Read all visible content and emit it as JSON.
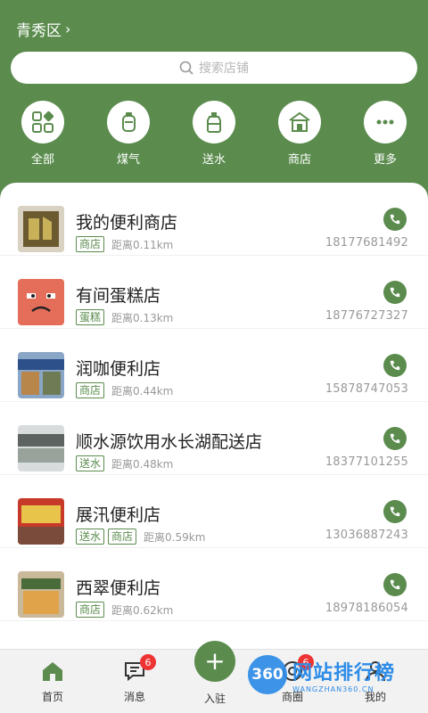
{
  "header": {
    "region": "青秀区",
    "search_placeholder": "搜索店铺"
  },
  "categories": [
    {
      "label": "全部",
      "icon": "grid-icon"
    },
    {
      "label": "煤气",
      "icon": "gas-cylinder-icon"
    },
    {
      "label": "送水",
      "icon": "water-bottle-icon"
    },
    {
      "label": "商店",
      "icon": "store-icon"
    },
    {
      "label": "更多",
      "icon": "more-icon"
    }
  ],
  "stores": [
    {
      "name": "我的便利商店",
      "tags": [
        "商店"
      ],
      "distance": "距离0.11km",
      "phone": "18177681492"
    },
    {
      "name": "有间蛋糕店",
      "tags": [
        "蛋糕"
      ],
      "distance": "距离0.13km",
      "phone": "18776727327"
    },
    {
      "name": "润咖便利店",
      "tags": [
        "商店"
      ],
      "distance": "距离0.44km",
      "phone": "15878747053"
    },
    {
      "name": "顺水源饮用水长湖配送店",
      "tags": [
        "送水"
      ],
      "distance": "距离0.48km",
      "phone": "18377101255"
    },
    {
      "name": "展汛便利店",
      "tags": [
        "送水",
        "商店"
      ],
      "distance": "距离0.59km",
      "phone": "13036887243"
    },
    {
      "name": "西翠便利店",
      "tags": [
        "商店"
      ],
      "distance": "距离0.62km",
      "phone": "18978186054"
    }
  ],
  "tabbar": {
    "home": "首页",
    "messages": "消息",
    "messages_badge": "6",
    "join": "入驻",
    "circle": "商圈",
    "circle_badge": "6",
    "mine": "我的"
  },
  "watermark": {
    "logo": "360",
    "cn": "网站排行榜",
    "en": "WANGZHAN360.CN"
  },
  "colors": {
    "brand": "#5b8c4e",
    "badge": "#e33333",
    "watermark": "#2d8ce8"
  }
}
